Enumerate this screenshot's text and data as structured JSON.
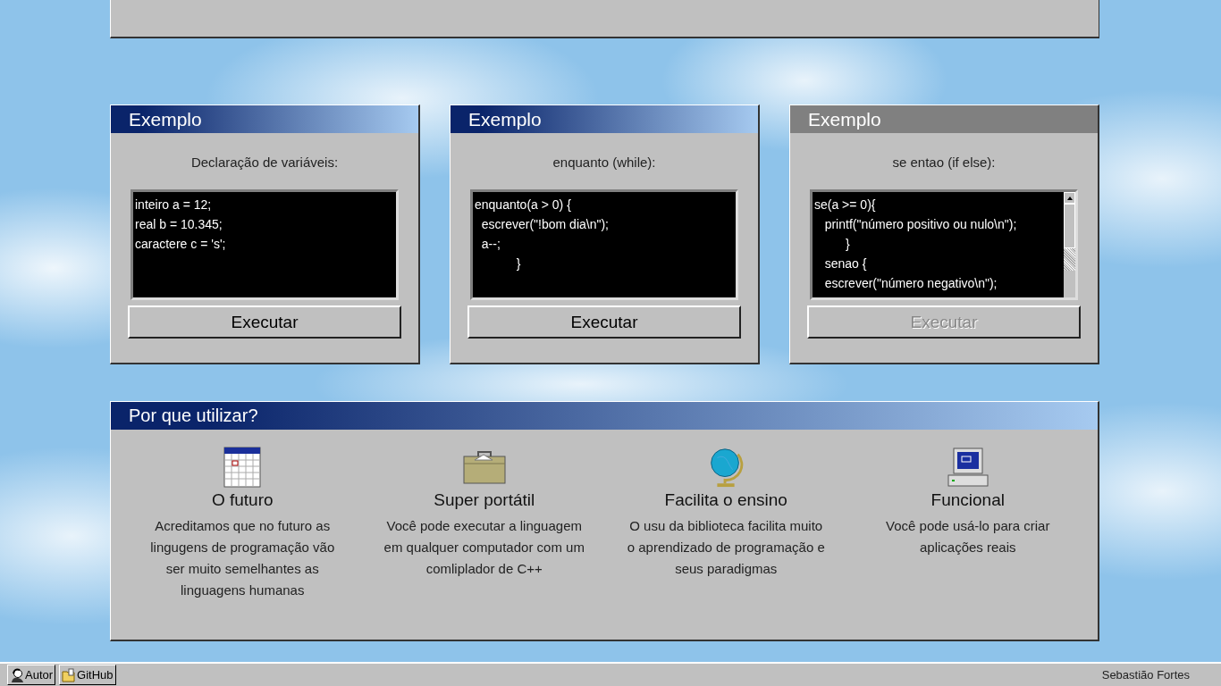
{
  "examples": [
    {
      "title": "Exemplo",
      "active": true,
      "caption": "Declaração de variáveis:",
      "code": [
        "inteiro a = 12;",
        "real b = 10.345;",
        "caractere c = 's';"
      ],
      "scrollable": false,
      "button": {
        "label": "Executar",
        "disabled": false
      }
    },
    {
      "title": "Exemplo",
      "active": true,
      "caption": "enquanto (while):",
      "code": [
        "enquanto(a > 0) {",
        "  escrever(\"!bom dia\\n\");",
        "  a--;",
        "            }"
      ],
      "scrollable": false,
      "button": {
        "label": "Executar",
        "disabled": false
      }
    },
    {
      "title": "Exemplo",
      "active": false,
      "caption": "se entao (if else):",
      "code": [
        "se(a >= 0){",
        "   printf(\"número positivo ou nulo\\n\");",
        "         }",
        "   senao {",
        "   escrever(\"número negativo\\n\");"
      ],
      "scrollable": true,
      "button": {
        "label": "Executar",
        "disabled": true
      }
    }
  ],
  "why": {
    "title": "Por que utilizar?",
    "features": [
      {
        "kind": "calendar",
        "title": "O futuro",
        "text": "Acreditamos que no futuro as lingugens de programação vão ser muito semelhantes as linguagens humanas"
      },
      {
        "kind": "briefcase",
        "title": "Super portátil",
        "text": "Você pode executar a linguagem em qualquer computador com um comliplador de C++"
      },
      {
        "kind": "globe",
        "title": "Facilita o ensino",
        "text": "O usu da biblioteca facilita muito o aprendizado de programação e seus paradigmas"
      },
      {
        "kind": "computer",
        "title": "Funcional",
        "text": "Você pode usá-lo para criar aplicações reais"
      }
    ]
  },
  "taskbar": {
    "buttons": [
      {
        "kind": "person",
        "label": "Autor"
      },
      {
        "kind": "folder",
        "label": "GitHub"
      }
    ],
    "author": "Sebastião Fortes"
  }
}
